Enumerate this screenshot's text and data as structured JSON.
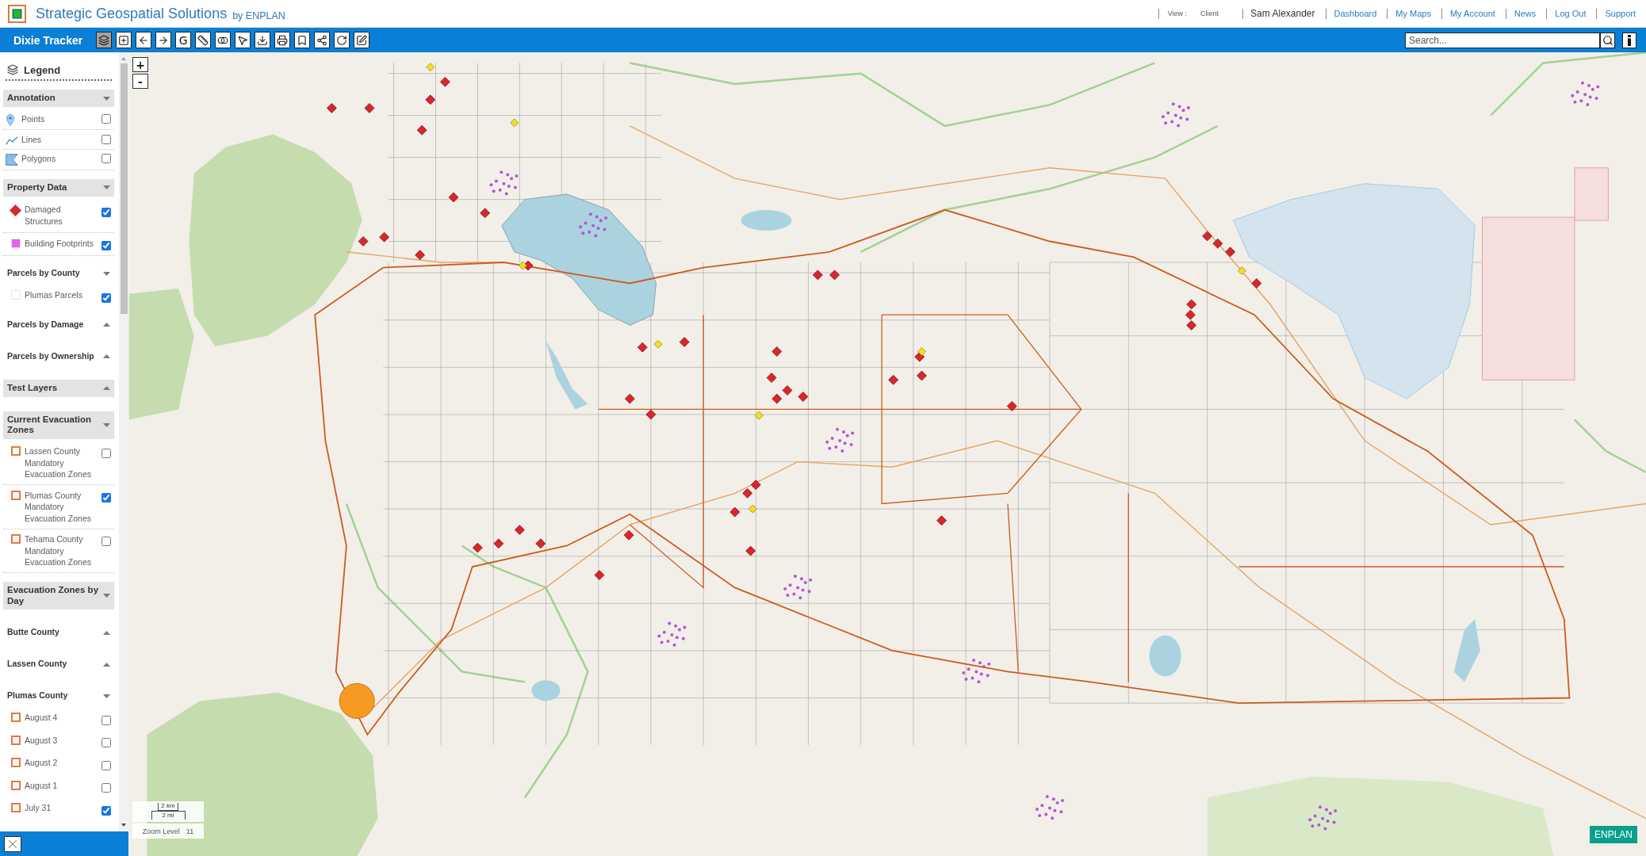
{
  "header": {
    "title": "Strategic Geospatial Solutions",
    "byline": "by ENPLAN",
    "view": {
      "label": "View :",
      "value": "Client"
    },
    "user": "Sam Alexander",
    "links": [
      "Dashboard",
      "My Maps",
      "My Account",
      "News",
      "Log Out",
      "Support"
    ]
  },
  "toolbar": {
    "title": "Dixie Tracker",
    "tools": [
      {
        "kind": "layers",
        "selected": true
      },
      {
        "kind": "add",
        "selected": false
      },
      {
        "kind": "back",
        "selected": false
      },
      {
        "kind": "forward",
        "selected": false
      },
      {
        "kind": "text",
        "label": "G",
        "selected": false
      },
      {
        "kind": "ruler",
        "selected": false
      },
      {
        "kind": "overlap",
        "selected": false
      },
      {
        "kind": "select",
        "selected": false
      },
      {
        "kind": "download",
        "selected": false
      },
      {
        "kind": "print",
        "selected": false
      },
      {
        "kind": "bookmark",
        "selected": false
      },
      {
        "kind": "share",
        "selected": false
      },
      {
        "kind": "refresh",
        "selected": false
      },
      {
        "kind": "edit",
        "selected": false
      }
    ],
    "search": {
      "placeholder": "Search..."
    }
  },
  "legend": {
    "title": "Legend",
    "sections": [
      {
        "kind": "group",
        "title": "Annotation",
        "expanded": true,
        "items": [
          {
            "kind": "pin",
            "label": "Points",
            "checked": false
          },
          {
            "kind": "line",
            "label": "Lines",
            "checked": false
          },
          {
            "kind": "polygon",
            "label": "Polygons",
            "checked": false
          }
        ]
      },
      {
        "kind": "group",
        "title": "Property Data",
        "expanded": true,
        "items": [
          {
            "kind": "diamond",
            "color": "#d7262e",
            "label": "Damaged Structures",
            "checked": true
          },
          {
            "kind": "fill",
            "color": "#f05cf0",
            "label": "Building Footprints",
            "checked": true
          }
        ]
      },
      {
        "kind": "subgroup",
        "title": "Parcels by County",
        "expanded": true,
        "items": [
          {
            "kind": "fill",
            "color": "#ffffff",
            "label": "Plumas Parcels",
            "checked": true
          }
        ]
      },
      {
        "kind": "subgroup",
        "title": "Parcels by Damage",
        "expanded": false
      },
      {
        "kind": "subgroup",
        "title": "Parcels by Ownership",
        "expanded": false
      },
      {
        "kind": "group",
        "title": "Test Layers",
        "expanded": false
      },
      {
        "kind": "group",
        "title": "Current Evacuation Zones",
        "expanded": true,
        "items": [
          {
            "kind": "outline",
            "color": "#e8783c",
            "label": "Lassen County Mandatory Evacuation Zones",
            "checked": false
          },
          {
            "kind": "outline",
            "color": "#e8783c",
            "label": "Plumas County Mandatory Evacuation Zones",
            "checked": true
          },
          {
            "kind": "outline",
            "color": "#e8783c",
            "label": "Tehama County Mandatory Evacuation Zones",
            "checked": false
          }
        ]
      },
      {
        "kind": "group",
        "title": "Evacuation Zones by Day",
        "expanded": true
      },
      {
        "kind": "subgroup",
        "title": "Butte County",
        "expanded": false
      },
      {
        "kind": "subgroup",
        "title": "Lassen County",
        "expanded": false
      },
      {
        "kind": "subgroup",
        "title": "Plumas County",
        "expanded": true,
        "items": [
          {
            "kind": "outline",
            "color": "#e8783c",
            "label": "August 4",
            "checked": false
          },
          {
            "kind": "outline",
            "color": "#e8783c",
            "label": "August 3",
            "checked": false
          },
          {
            "kind": "outline",
            "color": "#e8783c",
            "label": "August 2",
            "checked": false
          },
          {
            "kind": "outline",
            "color": "#e8783c",
            "label": "August 1",
            "checked": false
          },
          {
            "kind": "outline",
            "color": "#e8783c",
            "label": "July 31",
            "checked": true
          }
        ]
      }
    ]
  },
  "map": {
    "zoom_buttons": [
      "+",
      "-"
    ],
    "scale": {
      "metric": "2 km",
      "imperial": "2 mi"
    },
    "zoom_level": {
      "label": "Zoom Level",
      "value": "11"
    },
    "badge": "ENPLAN"
  }
}
